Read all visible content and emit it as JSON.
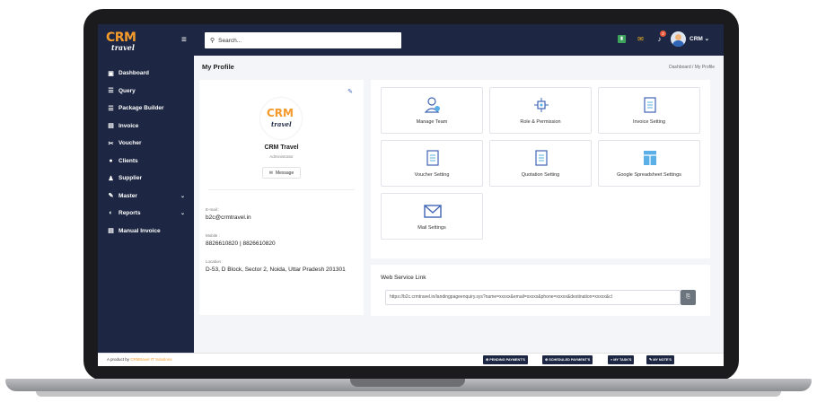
{
  "app": {
    "name": "CRM travel",
    "logo_main": "CRM",
    "logo_sub": "travel"
  },
  "sidebar": {
    "items": [
      {
        "label": "Dashboard",
        "icon": "calendar-icon"
      },
      {
        "label": "Query",
        "icon": "list-icon"
      },
      {
        "label": "Package Builder",
        "icon": "list-icon"
      },
      {
        "label": "Invoice",
        "icon": "receipt-icon"
      },
      {
        "label": "Voucher",
        "icon": "ticket-icon"
      },
      {
        "label": "Clients",
        "icon": "user-icon"
      },
      {
        "label": "Supplier",
        "icon": "users-icon"
      },
      {
        "label": "Master",
        "icon": "wrench-icon",
        "has_submenu": true
      },
      {
        "label": "Reports",
        "icon": "chart-icon",
        "has_submenu": true
      },
      {
        "label": "Manual Invoice",
        "icon": "receipt-icon"
      }
    ]
  },
  "topbar": {
    "search_placeholder": "Search...",
    "notification_count": "2",
    "user_label": "CRM ⌄"
  },
  "page": {
    "title": "My Profile",
    "breadcrumb": "Dashboard / My Profile"
  },
  "profile": {
    "name": "CRM Travel",
    "role": "Administrator",
    "message_button": "Message",
    "email_label": "E-mail :",
    "email": "b2c@crmtravel.in",
    "mobile_label": "Mobile :",
    "mobile": "8826610820 | 8826610820",
    "location_label": "Location :",
    "location": "D-53, D Block, Sector 2, Noida, Uttar Pradesh 201301"
  },
  "tiles": [
    {
      "label": "Manage Team",
      "icon": "team-icon"
    },
    {
      "label": "Role & Permission",
      "icon": "network-icon"
    },
    {
      "label": "Invoice Setting",
      "icon": "document-icon"
    },
    {
      "label": "Voucher Setting",
      "icon": "document-icon"
    },
    {
      "label": "Quotation Setting",
      "icon": "document-icon"
    },
    {
      "label": "Google Spreadsheet Settings",
      "icon": "spreadsheet-icon"
    },
    {
      "label": "Mail Settings",
      "icon": "mail-icon"
    }
  ],
  "web_service": {
    "title": "Web Service Link",
    "url": "https://b2c.crmtravel.in/landingpageenquiry.sys?name=xxxxx&email=xxxxx&phone=xxxxx&destination=xxxxx&cl"
  },
  "footer": {
    "text_prefix": "A product by ",
    "brand": "CRMtravel IT Solutions",
    "buttons": [
      "⊕ PENDING PAYMENT'S",
      "⊕ SCHEDULED PAYMENT'S",
      "≡ MY TASK'S",
      "✎ MY NOTE'S"
    ]
  }
}
